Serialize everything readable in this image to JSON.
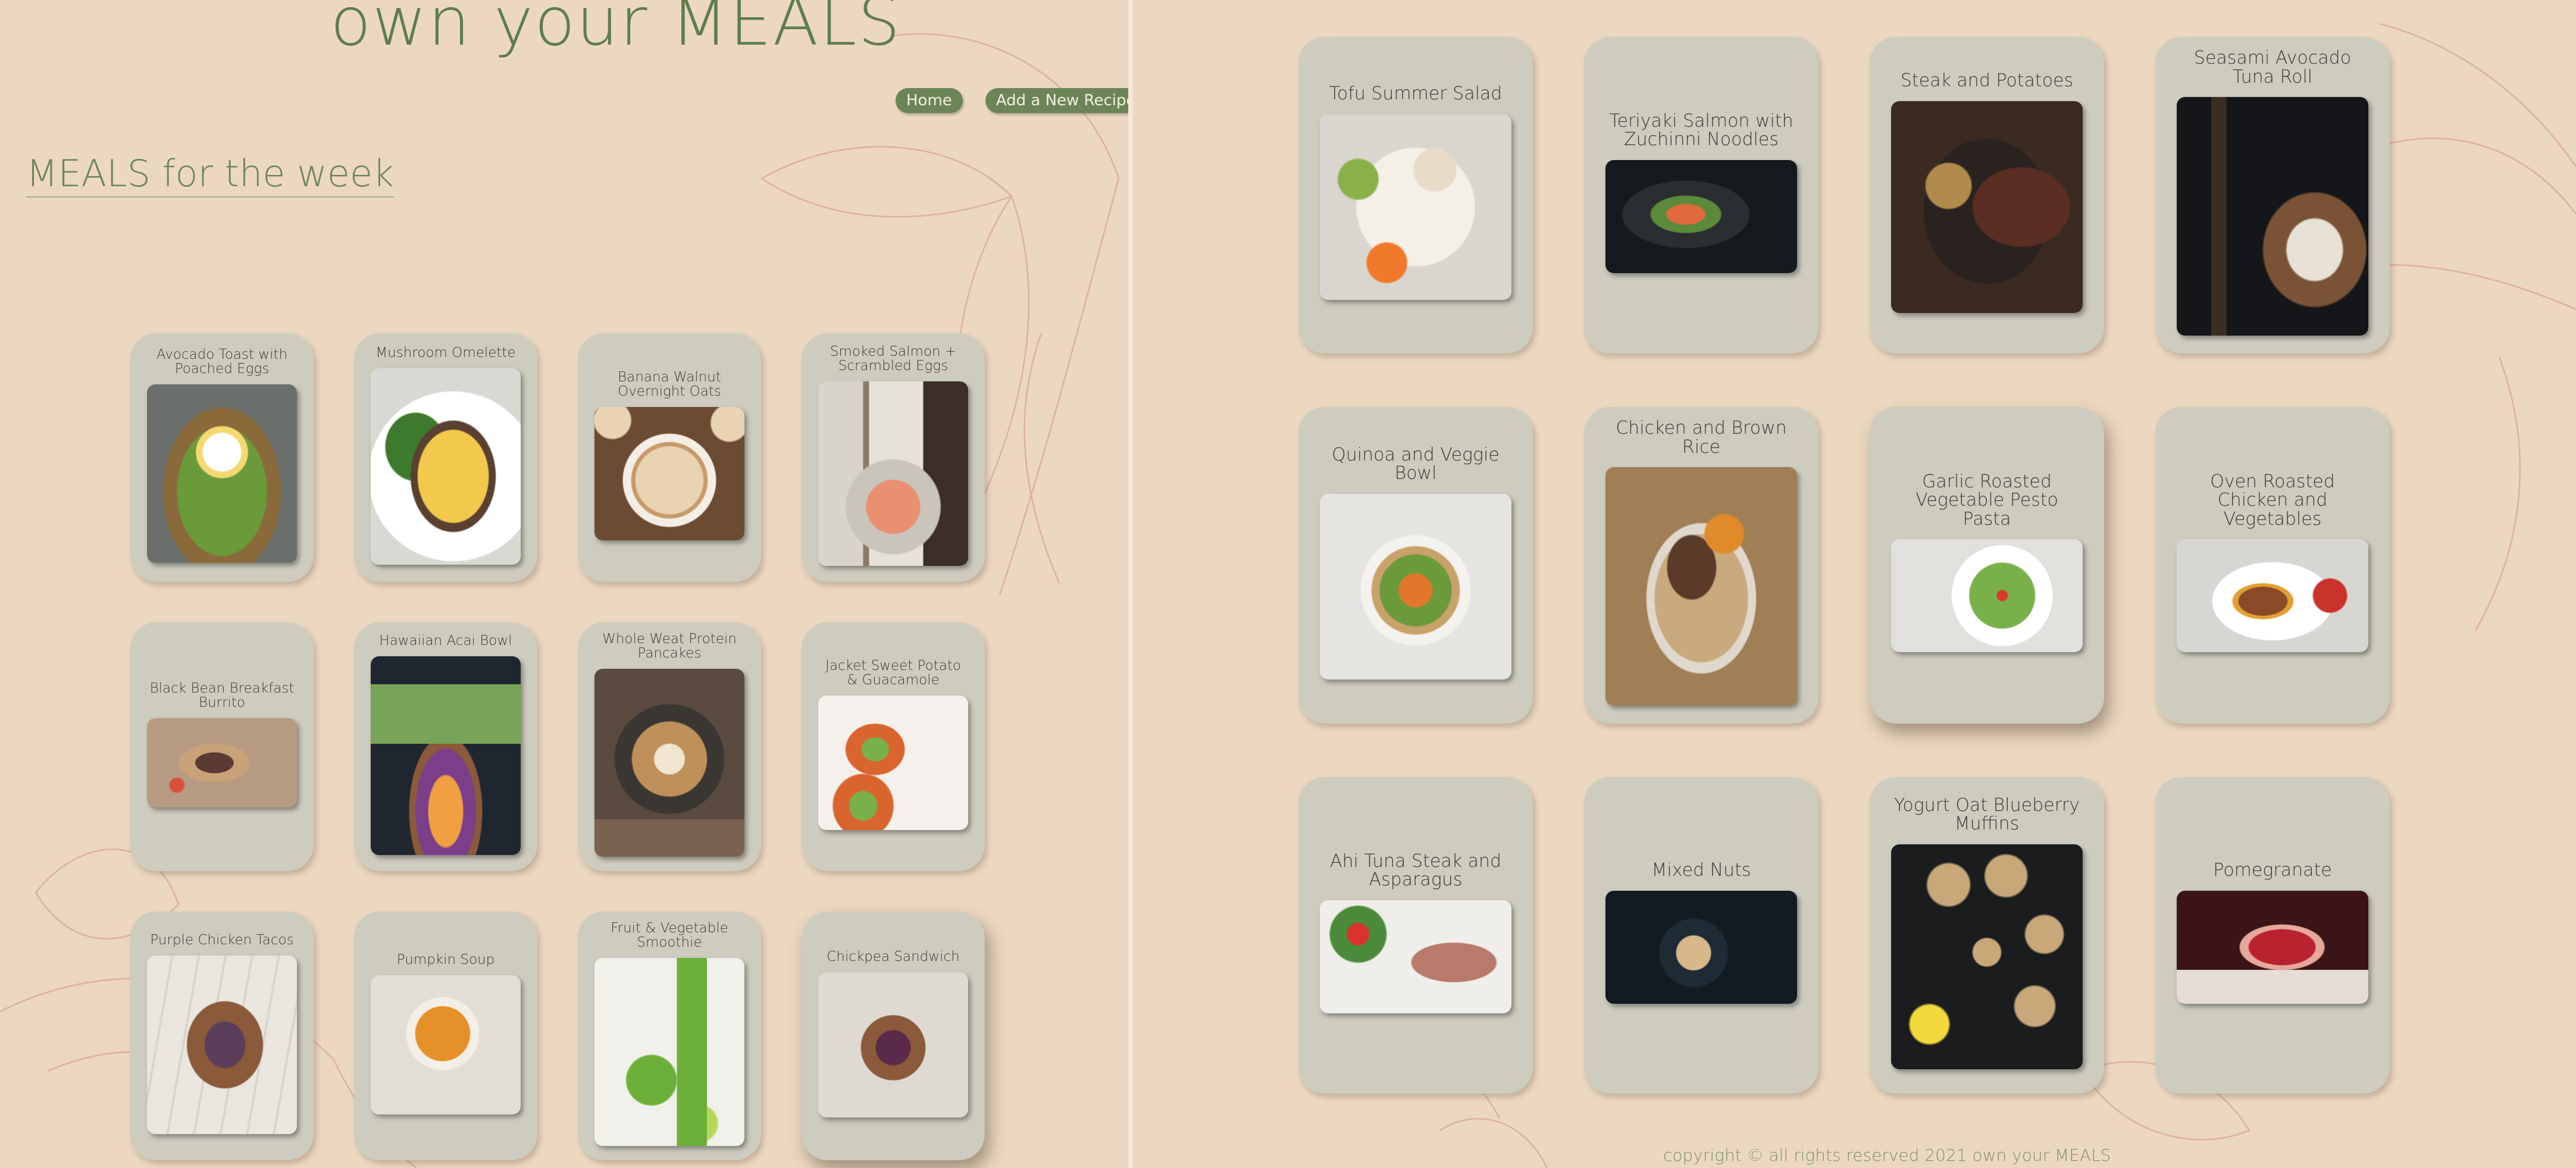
{
  "site_title": "own your MEALS",
  "nav": {
    "home": "Home",
    "add_recipe": "Add a New Recipe"
  },
  "section_title": "MEALS for the week",
  "footer": "copyright © all rights reserved 2021 own your MEALS",
  "colors": {
    "background": "#ecd8c0",
    "card": "#cdccbf",
    "accent": "#5e7d4d",
    "button": "#6b8557"
  },
  "left_meals": [
    {
      "title": "Avocado Toast with Poached Eggs"
    },
    {
      "title": "Mushroom Omelette"
    },
    {
      "title": "Banana Walnut Overnight Oats"
    },
    {
      "title": "Smoked Salmon + Scrambled Eggs"
    },
    {
      "title": "Black Bean Breakfast Burrito"
    },
    {
      "title": "Hawaiian Acai Bowl"
    },
    {
      "title": "Whole Weat Protein Pancakes"
    },
    {
      "title": "Jacket Sweet Potato & Guacamole"
    },
    {
      "title": "Purple Chicken Tacos"
    },
    {
      "title": "Pumpkin Soup"
    },
    {
      "title": "Fruit & Vegetable Smoothie"
    },
    {
      "title": "Chickpea Sandwich"
    }
  ],
  "right_meals": [
    {
      "title": "Tofu Summer Salad"
    },
    {
      "title": "Teriyaki Salmon with Zuchinni Noodles"
    },
    {
      "title": "Steak and Potatoes"
    },
    {
      "title": "Seasami Avocado Tuna Roll"
    },
    {
      "title": "Quinoa and Veggie Bowl"
    },
    {
      "title": "Chicken and Brown Rice"
    },
    {
      "title": "Garlic Roasted Vegetable Pesto Pasta"
    },
    {
      "title": "Oven Roasted Chicken and Vegetables"
    },
    {
      "title": "Ahi Tuna Steak and Asparagus"
    },
    {
      "title": "Mixed Nuts"
    },
    {
      "title": "Yogurt Oat Blueberry Muffins"
    },
    {
      "title": "Pomegranate"
    }
  ]
}
